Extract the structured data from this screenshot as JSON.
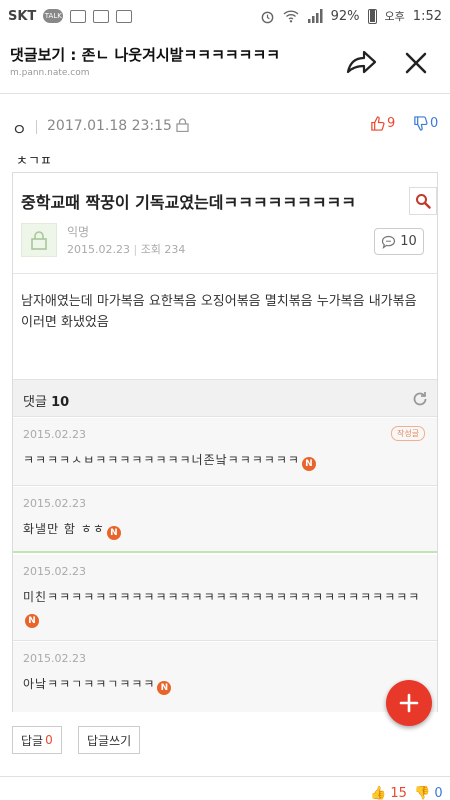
{
  "status_bar": {
    "carrier": "SKT",
    "talk_label": "TALK",
    "battery": "92%",
    "time": "1:52",
    "ampm": "오후"
  },
  "header": {
    "title": "댓글보기 : 존ㄴ 나웃겨시발ㅋㅋㅋㅋㅋㅋㅋ",
    "url": "m.pann.nate.com"
  },
  "comment": {
    "author": "ㅇ",
    "date": "2017.01.18 23:15",
    "up_count": "9",
    "down_count": "0",
    "text": "ㅊㄱㅍ"
  },
  "embedded": {
    "post_title": "중학교때 짝꿍이 기독교였는데ㅋㅋㅋㅋㅋㅋㅋㅋㅋ",
    "author": "익명",
    "date": "2015.02.23",
    "views": "조회 234",
    "comment_count": "10",
    "body": "남자애였는데 마가복음 요한복음 오징어볶음 멸치볶음 누가복음 내가볶음 이러면 화냈었음",
    "comments_label": "댓글",
    "comments_total": "10",
    "comments": [
      {
        "date": "2015.02.23",
        "text": "ㅋㅋㅋㅋㅅㅂㅋㅋㅋㅋㅋㅋㅋㅋ너존낰ㅋㅋㅋㅋㅋㅋ",
        "badge": "N",
        "extra": "작성글"
      },
      {
        "date": "2015.02.23",
        "text": "화낼만 함 ㅎㅎ",
        "badge": "N"
      },
      {
        "date": "2015.02.23",
        "text": "미친ㅋㅋㅋㅋㅋㅋㅋㅋㅋㅋㅋㅋㅋㅋㅋㅋㅋㅋㅋㅋㅋㅋㅋㅋㅋㅋㅋㅋㅋㅋㅋ",
        "badge": "N"
      },
      {
        "date": "2015.02.23",
        "text": "아낰ㅋㅋㄱㅋㅋㄱㅋㅋㅋ",
        "badge": "N"
      }
    ]
  },
  "actions": {
    "reply_label": "답글",
    "reply_count": "0",
    "write_label": "답글쓰기"
  },
  "next_comment": {
    "up_count": "15",
    "down_count": "0"
  },
  "colors": {
    "accent_red": "#e8382a",
    "up_red": "#e84a2f",
    "down_blue": "#3a7bd5",
    "badge_orange": "#e8642b"
  }
}
